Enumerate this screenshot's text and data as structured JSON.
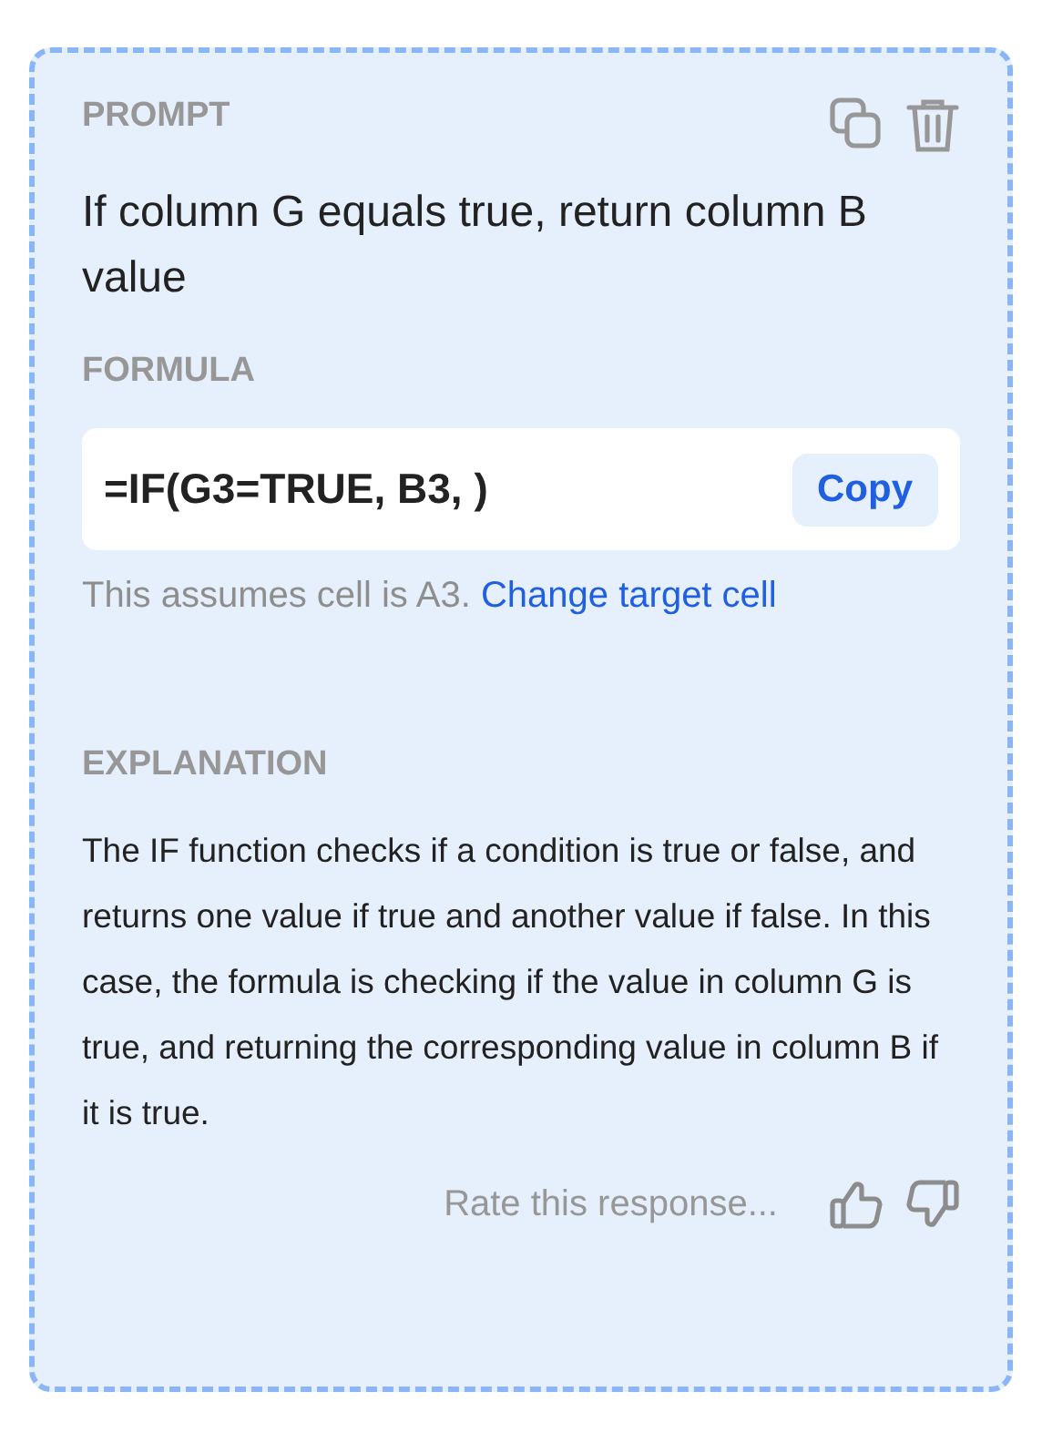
{
  "prompt": {
    "label": "PROMPT",
    "text": "If column G equals true, return column B value"
  },
  "formula": {
    "label": "FORMULA",
    "value": "=IF(G3=TRUE, B3, )",
    "copy_button": "Copy",
    "note": "This assumes cell is A3.",
    "note_link": "Change target cell"
  },
  "explanation": {
    "label": "EXPLANATION",
    "text": "The IF function checks if a condition is true or false, and returns one value if true and another value if false. In this case, the formula is checking if the value in column G is true, and returning the corresponding value in column B if it is true."
  },
  "rating": {
    "prompt": "Rate this response..."
  }
}
